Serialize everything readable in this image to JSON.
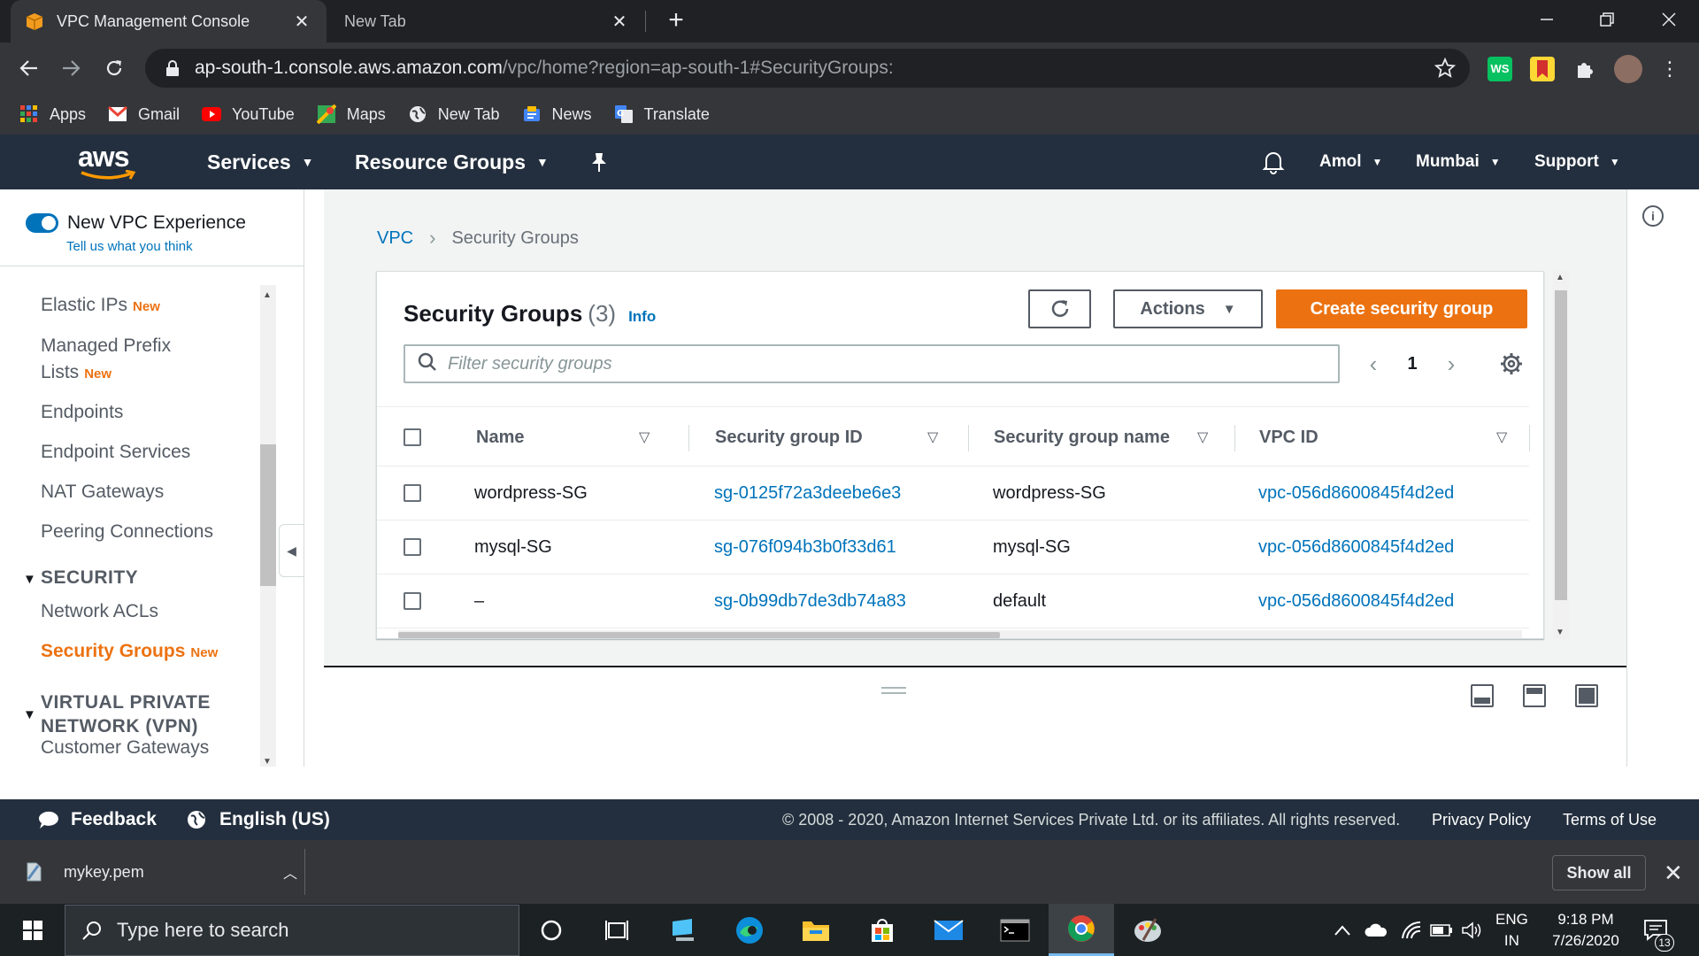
{
  "browser": {
    "tabs": [
      {
        "title": "VPC Management Console",
        "active": true
      },
      {
        "title": "New Tab",
        "active": false
      }
    ],
    "url_host": "ap-south-1.console.aws.amazon.com",
    "url_path": "/vpc/home?region=ap-south-1#SecurityGroups:",
    "bookmarks": [
      "Apps",
      "Gmail",
      "YouTube",
      "Maps",
      "New Tab",
      "News",
      "Translate"
    ],
    "extensions": [
      "ws-extension-icon",
      "bookmark-extension-icon",
      "puzzle-icon",
      "profile-avatar"
    ]
  },
  "aws_header": {
    "logo": "aws",
    "services": "Services",
    "resource_groups": "Resource Groups",
    "user": "Amol",
    "region": "Mumbai",
    "support": "Support"
  },
  "leftnav": {
    "toggle_label": "New VPC Experience",
    "feedback_link": "Tell us what you think",
    "new_badge": "New",
    "items": {
      "elastic_ips": "Elastic IPs",
      "managed_prefix_1": "Managed Prefix",
      "managed_prefix_2": "Lists",
      "endpoints": "Endpoints",
      "endpoint_services": "Endpoint Services",
      "nat_gateways": "NAT Gateways",
      "peering": "Peering Connections",
      "network_acls": "Network ACLs",
      "security_groups": "Security Groups",
      "customer_gateways": "Customer Gateways"
    },
    "sections": {
      "security": "SECURITY",
      "vpn_1": "VIRTUAL PRIVATE",
      "vpn_2": "NETWORK (VPN)"
    }
  },
  "breadcrumb": {
    "root": "VPC",
    "current": "Security Groups"
  },
  "panel": {
    "title": "Security Groups",
    "count": "(3)",
    "info": "Info",
    "actions": "Actions",
    "create": "Create security group",
    "search_placeholder": "Filter security groups",
    "page": "1"
  },
  "table": {
    "columns": [
      "Name",
      "Security group ID",
      "Security group name",
      "VPC ID"
    ],
    "rows": [
      {
        "name": "wordpress-SG",
        "sg_id": "sg-0125f72a3deebe6e3",
        "sg_name": "wordpress-SG",
        "vpc_id": "vpc-056d8600845f4d2ed"
      },
      {
        "name": "mysql-SG",
        "sg_id": "sg-076f094b3b0f33d61",
        "sg_name": "mysql-SG",
        "vpc_id": "vpc-056d8600845f4d2ed"
      },
      {
        "name": "–",
        "sg_id": "sg-0b99db7de3db74a83",
        "sg_name": "default",
        "vpc_id": "vpc-056d8600845f4d2ed"
      }
    ]
  },
  "footer": {
    "feedback": "Feedback",
    "language": "English (US)",
    "copyright": "© 2008 - 2020, Amazon Internet Services Private Ltd. or its affiliates. All rights reserved.",
    "privacy": "Privacy Policy",
    "terms": "Terms of Use"
  },
  "download": {
    "file": "mykey.pem",
    "show_all": "Show all"
  },
  "taskbar": {
    "search_placeholder": "Type here to search",
    "lang_1": "ENG",
    "lang_2": "IN",
    "time": "9:18 PM",
    "date": "7/26/2020",
    "notifications": "13"
  },
  "colors": {
    "aws_orange": "#ec7211",
    "aws_navy": "#232f3e",
    "link_blue": "#0073bb"
  }
}
